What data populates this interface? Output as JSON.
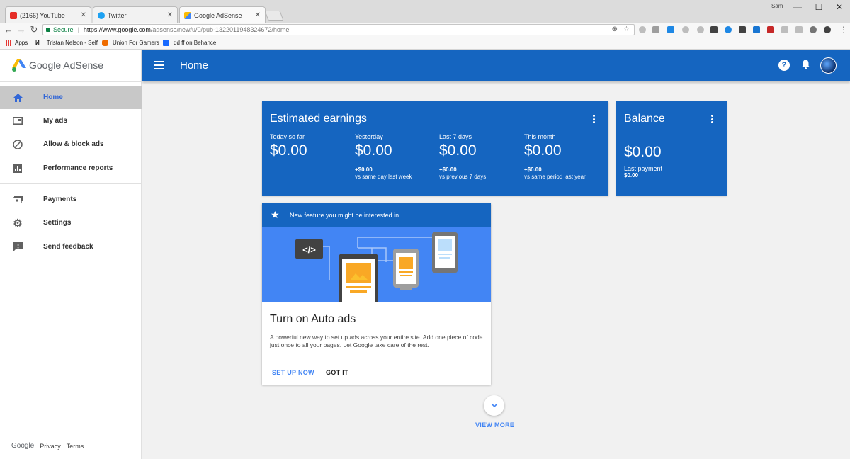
{
  "browser": {
    "tabs": [
      {
        "label": "(2166) YouTube",
        "favicon_color": "#e52d27"
      },
      {
        "label": "Twitter",
        "favicon_color": "#1da1f2"
      },
      {
        "label": "Google AdSense",
        "favicon_color": "#fbbc04"
      }
    ],
    "profile_name": "Sam",
    "window_controls": {
      "minimize": "—",
      "maximize": "☐",
      "close": "✕"
    },
    "address_bar": {
      "secure_label": "Secure",
      "url_host": "https://www.google.com",
      "url_path": "/adsense/new/u/0/pub-1322011948324672/home"
    },
    "bookmarks": [
      {
        "label": "Apps",
        "icon": "apps-grid-icon"
      },
      {
        "label": "Tristan Nelson - Self",
        "icon": "N-icon"
      },
      {
        "label": "Union For Gamers",
        "icon": "gamepad-icon"
      },
      {
        "label": "dd ff on Behance",
        "icon": "behance-icon"
      }
    ]
  },
  "sidebar": {
    "brand": "Google AdSense",
    "items": [
      {
        "label": "Home",
        "icon": "home-icon",
        "active": true
      },
      {
        "label": "My ads",
        "icon": "ads-icon"
      },
      {
        "label": "Allow & block ads",
        "icon": "block-icon"
      },
      {
        "label": "Performance reports",
        "icon": "bar-chart-icon"
      },
      {
        "label": "Payments",
        "icon": "payments-icon"
      },
      {
        "label": "Settings",
        "icon": "gear-icon"
      },
      {
        "label": "Send feedback",
        "icon": "feedback-icon"
      }
    ],
    "footer": {
      "google": "Google",
      "privacy": "Privacy",
      "terms": "Terms"
    }
  },
  "header": {
    "title": "Home"
  },
  "earnings": {
    "title": "Estimated earnings",
    "stats": [
      {
        "label": "Today so far",
        "value": "$0.00",
        "delta": "",
        "compare": ""
      },
      {
        "label": "Yesterday",
        "value": "$0.00",
        "delta": "+$0.00",
        "compare": "vs same day last week"
      },
      {
        "label": "Last 7 days",
        "value": "$0.00",
        "delta": "+$0.00",
        "compare": "vs previous 7 days"
      },
      {
        "label": "This month",
        "value": "$0.00",
        "delta": "+$0.00",
        "compare": "vs same period last year"
      }
    ]
  },
  "balance": {
    "title": "Balance",
    "value": "$0.00",
    "last_payment_label": "Last payment",
    "last_payment_value": "$0.00"
  },
  "feature": {
    "header": "New feature you might be interested in",
    "title": "Turn on Auto ads",
    "body": "A powerful new way to set up ads across your entire site. Add one piece of code just once to all your pages. Let Google take care of the rest.",
    "primary_button": "SET UP NOW",
    "secondary_button": "GOT IT",
    "code_glyph": "</>"
  },
  "view_more": "VIEW MORE",
  "colors": {
    "brand_blue": "#1565c0",
    "accent_blue": "#4285f4",
    "active_nav_bg": "#c8c8c8"
  }
}
